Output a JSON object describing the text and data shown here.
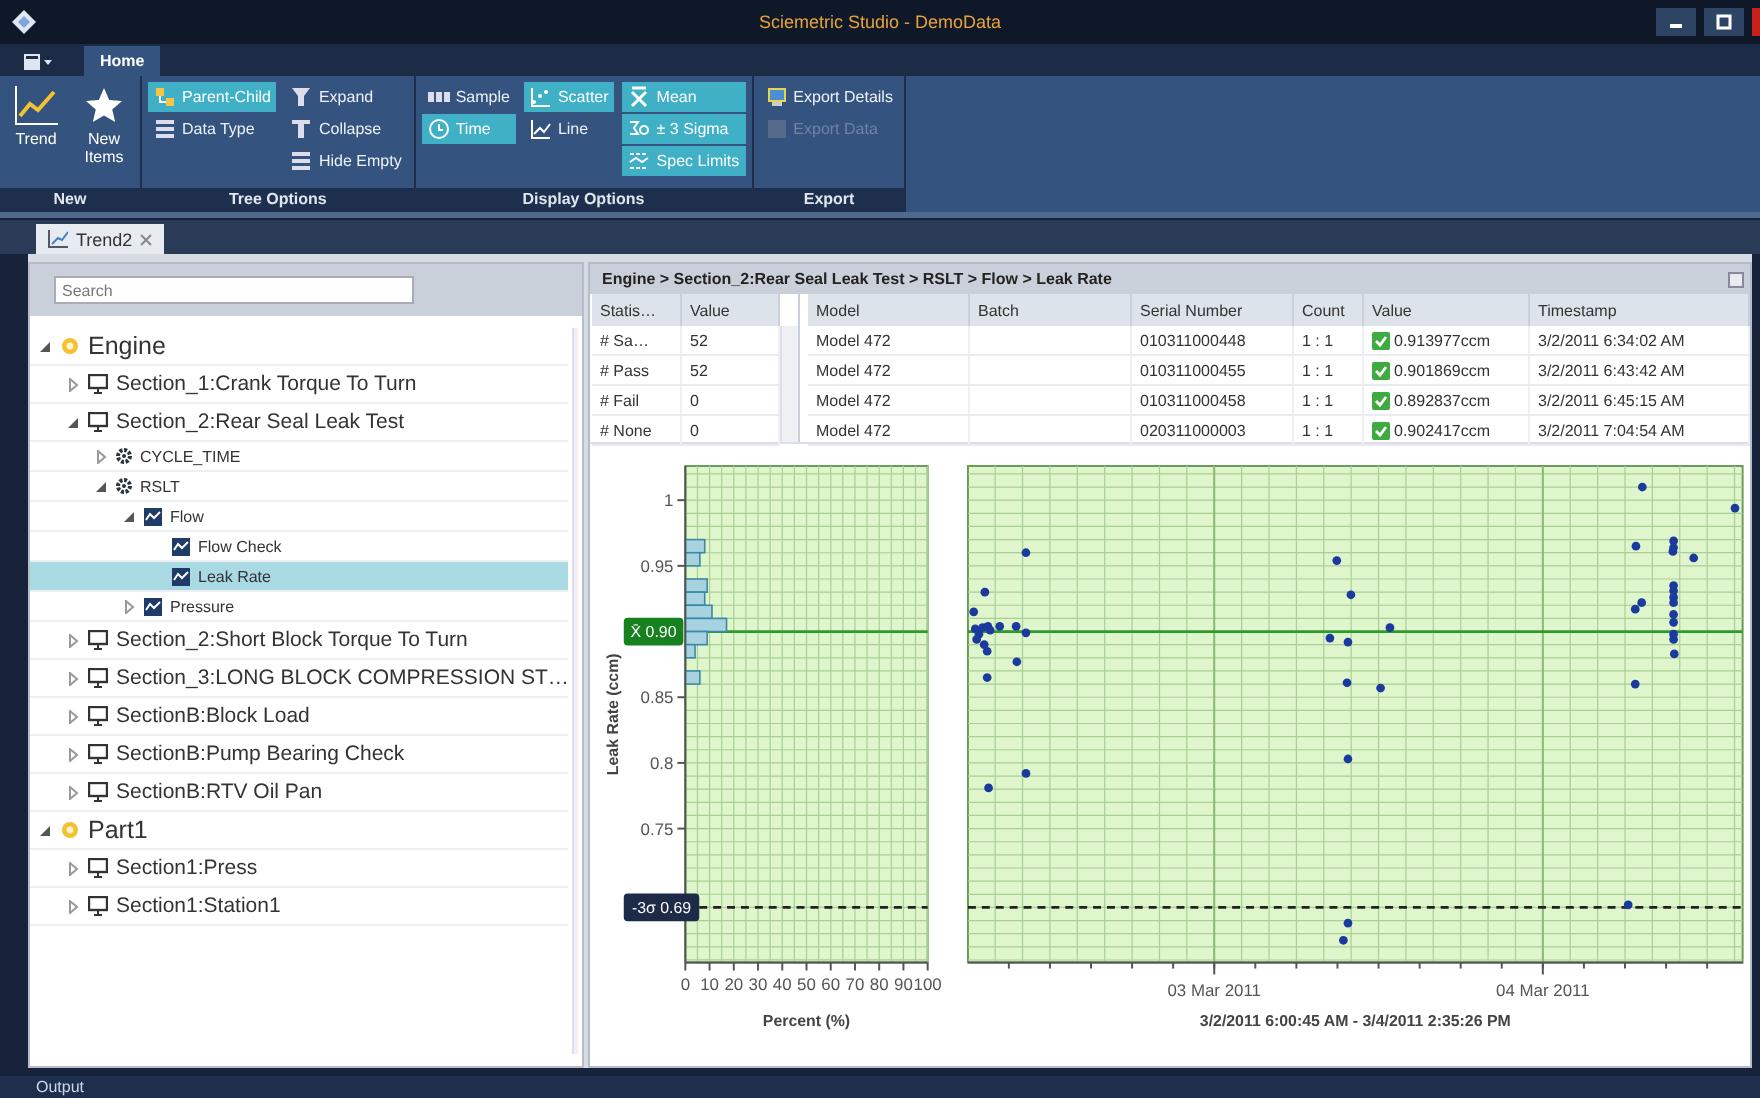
{
  "window": {
    "title": "Sciemetric Studio - DemoData"
  },
  "ribbon": {
    "tabs": [
      {
        "label": "Home",
        "selected": true
      }
    ],
    "groups": [
      {
        "label": "New",
        "columns": [
          [
            {
              "label": "Trend",
              "kind": "large"
            }
          ],
          [
            {
              "label": "New Items",
              "kind": "large"
            }
          ]
        ]
      },
      {
        "label": "Tree Options",
        "columns": [
          [
            {
              "label": "Parent-Child",
              "kind": "small",
              "selected": true
            },
            {
              "label": "Data Type",
              "kind": "small",
              "selected": false
            }
          ],
          [
            {
              "label": "Expand",
              "kind": "small"
            },
            {
              "label": "Collapse",
              "kind": "small"
            },
            {
              "label": "Hide Empty",
              "kind": "small"
            }
          ]
        ]
      },
      {
        "label": "Display Options",
        "columns": [
          [
            {
              "label": "Sample",
              "kind": "small",
              "selected": false
            },
            {
              "label": "Time",
              "kind": "small",
              "selected": true
            }
          ],
          [
            {
              "label": "Scatter",
              "kind": "small",
              "selected": true
            },
            {
              "label": "Line",
              "kind": "small",
              "selected": false
            }
          ],
          [
            {
              "label": "Mean",
              "kind": "small",
              "on": true
            },
            {
              "label": "± 3 Sigma",
              "kind": "small",
              "on": true
            },
            {
              "label": "Spec Limits",
              "kind": "small",
              "on": true
            }
          ]
        ]
      },
      {
        "label": "Export",
        "columns": [
          [
            {
              "label": "Export Details",
              "kind": "small",
              "disabled": false
            },
            {
              "label": "Export Data",
              "kind": "small",
              "disabled": true
            }
          ]
        ]
      }
    ]
  },
  "document_tabs": [
    {
      "label": "Trend2",
      "selected": true
    }
  ],
  "tree_panel": {
    "search": {
      "placeholder": "Search"
    },
    "tree": [
      {
        "label": "Engine",
        "kind": "part",
        "expanded": true,
        "selected": false,
        "children": [
          {
            "label": "Section_1:Crank Torque To Turn",
            "kind": "station",
            "expanded": false,
            "selected": false
          },
          {
            "label": "Section_2:Rear Seal Leak Test",
            "kind": "station",
            "expanded": true,
            "selected": false,
            "children": [
              {
                "label": "CYCLE_TIME",
                "kind": "process",
                "expanded": false,
                "selected": false
              },
              {
                "label": "RSLT",
                "kind": "process",
                "expanded": true,
                "selected": false,
                "children": [
                  {
                    "label": "Flow",
                    "kind": "parameter",
                    "expanded": true,
                    "selected": false,
                    "children": [
                      {
                        "label": "Flow Check",
                        "kind": "parameter",
                        "selected": false
                      },
                      {
                        "label": "Leak Rate",
                        "kind": "parameter",
                        "selected": true
                      }
                    ]
                  },
                  {
                    "label": "Pressure",
                    "kind": "parameter",
                    "expanded": false,
                    "selected": false
                  }
                ]
              }
            ]
          },
          {
            "label": "Section_2:Short Block Torque To Turn",
            "kind": "station",
            "expanded": false,
            "selected": false
          },
          {
            "label": "Section_3:LONG BLOCK COMPRESSION ST…",
            "kind": "station",
            "expanded": false,
            "selected": false
          },
          {
            "label": "SectionB:Block Load",
            "kind": "station",
            "expanded": false,
            "selected": false
          },
          {
            "label": "SectionB:Pump Bearing Check",
            "kind": "station",
            "expanded": false,
            "selected": false
          },
          {
            "label": "SectionB:RTV Oil Pan",
            "kind": "station",
            "expanded": false,
            "selected": false
          }
        ]
      },
      {
        "label": "Part1",
        "kind": "part",
        "expanded": true,
        "selected": false,
        "children": [
          {
            "label": "Section1:Press",
            "kind": "station",
            "expanded": false,
            "selected": false
          },
          {
            "label": "Section1:Station1",
            "kind": "station",
            "expanded": false,
            "selected": false
          }
        ]
      }
    ]
  },
  "trend": {
    "breadcrumb": "Engine > Section_2:Rear Seal Leak Test > RSLT > Flow > Leak Rate",
    "stats_table": {
      "columns": [
        "Statis…",
        "Value"
      ],
      "rows": [
        {
          "label": "# Sa…",
          "value": "52"
        },
        {
          "label": "# Pass",
          "value": "52"
        },
        {
          "label": "# Fail",
          "value": "0"
        },
        {
          "label": "# None",
          "value": "0"
        }
      ]
    },
    "results_table": {
      "columns": [
        "Model",
        "Batch",
        "Serial Number",
        "Count",
        "Value",
        "Timestamp"
      ],
      "rows": [
        {
          "model": "Model 472",
          "serial": "010311000448",
          "count": "1 : 1",
          "value": "0.913977ccm",
          "timestamp": "3/2/2011 6:34:02 AM",
          "passed": true
        },
        {
          "model": "Model 472",
          "serial": "010311000455",
          "count": "1 : 1",
          "value": "0.901869ccm",
          "timestamp": "3/2/2011 6:43:42 AM",
          "passed": true
        },
        {
          "model": "Model 472",
          "serial": "010311000458",
          "count": "1 : 1",
          "value": "0.892837ccm",
          "timestamp": "3/2/2011 6:45:15 AM",
          "passed": true
        },
        {
          "model": "Model 472",
          "serial": "020311000003",
          "count": "1 : 1",
          "value": "0.902417ccm",
          "timestamp": "3/2/2011 7:04:54 AM",
          "passed": true
        }
      ]
    },
    "histogram": {
      "chart_data": {
        "type": "bar",
        "orientation": "horizontal",
        "xlabel": "Percent (%)",
        "ylabel": "Leak Rate (ccm)",
        "x": [
          0.965,
          0.955,
          0.935,
          0.925,
          0.915,
          0.905,
          0.895,
          0.885,
          0.865
        ],
        "series": [
          {
            "color": "#a6d3df",
            "values": [
              8,
              6,
              9,
              8,
              11,
              17,
              9,
              4,
              6
            ]
          }
        ],
        "grid": true,
        "xlim": [
          0,
          100
        ],
        "ylim": [
          0.648,
          1.026
        ],
        "xticks": [
          0,
          10,
          20,
          30,
          40,
          50,
          60,
          70,
          80,
          90,
          100
        ],
        "yticks": [
          1,
          0.95,
          0.85,
          0.8,
          0.75
        ],
        "ref_lines": [
          {
            "axis": "y",
            "value": 0.9,
            "label": "X̄ 0.90",
            "color": "#2c9a2c"
          },
          {
            "axis": "y",
            "value": 0.69,
            "label": "-3σ 0.69",
            "color": "#222222"
          }
        ]
      }
    },
    "scatter": {
      "chart_data": {
        "type": "scatter",
        "xlabel": "3/2/2011 6:00:45 AM - 3/4/2011 2:35:26 PM",
        "x": [
          "2011-03-02T06:26",
          "2011-03-02T07:15",
          "2011-03-02T06:33",
          "2011-03-02T06:49",
          "2011-03-02T07:05",
          "2011-03-02T07:28",
          "2011-03-02T07:38",
          "2011-03-02T06:39",
          "2011-03-02T07:12",
          "2011-03-02T07:25",
          "2011-03-02T08:20",
          "2011-03-02T09:32",
          "2011-03-02T10:15",
          "2011-03-02T09:35",
          "2011-03-02T07:25",
          "2011-03-02T10:15",
          "2011-03-02T07:31",
          "2011-03-02T10:15",
          "2011-03-03T08:57",
          "2011-03-03T09:59",
          "2011-03-03T08:27",
          "2011-03-03T09:46",
          "2011-03-03T12:50",
          "2011-03-03T09:42",
          "2011-03-03T12:09",
          "2011-03-03T09:46",
          "2011-03-03T09:46",
          "2011-03-03T09:26",
          "2011-03-04T07:16",
          "2011-03-04T06:48",
          "2011-03-04T09:33",
          "2011-03-04T09:30",
          "2011-03-04T09:33",
          "2011-03-04T11:01",
          "2011-03-04T06:45",
          "2011-03-04T07:13",
          "2011-03-04T09:33",
          "2011-03-04T09:33",
          "2011-03-04T09:33",
          "2011-03-04T09:33",
          "2011-03-04T09:33",
          "2011-03-04T09:33",
          "2011-03-04T09:33",
          "2011-03-04T09:33",
          "2011-03-04T09:36",
          "2011-03-04T06:45",
          "2011-03-04T06:14",
          "2011-03-04T14:02"
        ],
        "series": [
          {
            "color": "#1b3a9e",
            "values": [
              0.915,
              0.93,
              0.902,
              0.898,
              0.903,
              0.904,
              0.901,
              0.894,
              0.89,
              0.885,
              0.904,
              0.904,
              0.899,
              0.877,
              0.865,
              0.96,
              0.781,
              0.792,
              0.954,
              0.928,
              0.895,
              0.892,
              0.903,
              0.861,
              0.857,
              0.803,
              0.678,
              0.665,
              1.01,
              0.965,
              0.969,
              0.961,
              0.964,
              0.956,
              0.917,
              0.922,
              0.935,
              0.931,
              0.926,
              0.922,
              0.913,
              0.907,
              0.898,
              0.894,
              0.883,
              0.86,
              0.692,
              0.994
            ]
          }
        ],
        "xlim": [
          "2011-03-02T06:00:45",
          "2011-03-04T14:35:26"
        ],
        "ylim": [
          0.648,
          1.026
        ],
        "grid": true,
        "xticks": [
          {
            "value": "2011-03-03T00:00",
            "label": "03 Mar 2011"
          },
          {
            "value": "2011-03-04T00:00",
            "label": "04 Mar 2011"
          }
        ],
        "ref_lines": [
          {
            "axis": "y",
            "value": 0.9,
            "color": "#2c9a2c"
          },
          {
            "axis": "y",
            "value": 0.69,
            "color": "#222222"
          }
        ]
      }
    }
  },
  "status_bar": {
    "label": "Output"
  }
}
